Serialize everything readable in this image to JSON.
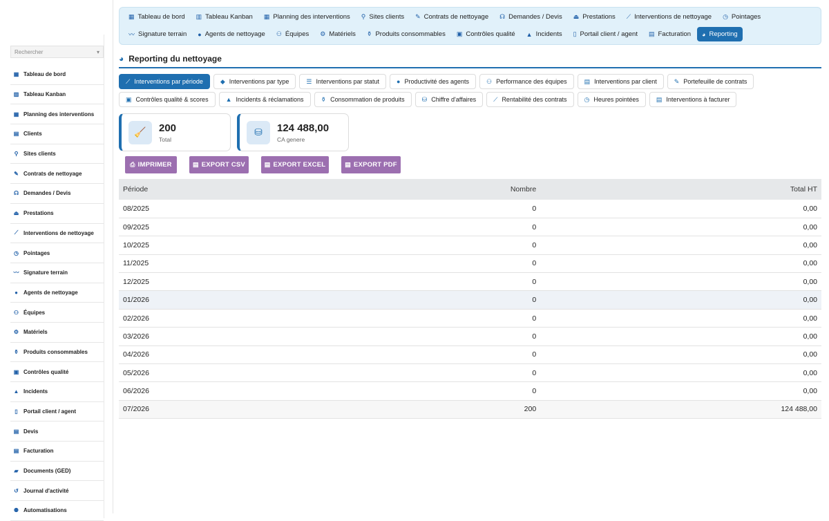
{
  "sidebar": {
    "search_placeholder": "Rechercher",
    "items": [
      {
        "label": "Tableau de bord",
        "icon": "dashboard-icon"
      },
      {
        "label": "Tableau Kanban",
        "icon": "kanban-icon"
      },
      {
        "label": "Planning des interventions",
        "icon": "calendar-icon"
      },
      {
        "label": "Clients",
        "icon": "building-icon"
      },
      {
        "label": "Sites clients",
        "icon": "map-pin-icon"
      },
      {
        "label": "Contrats de nettoyage",
        "icon": "contract-icon"
      },
      {
        "label": "Demandes / Devis",
        "icon": "headset-icon"
      },
      {
        "label": "Prestations",
        "icon": "service-icon"
      },
      {
        "label": "Interventions de nettoyage",
        "icon": "broom-icon"
      },
      {
        "label": "Pointages",
        "icon": "clock-icon"
      },
      {
        "label": "Signature terrain",
        "icon": "signature-icon"
      },
      {
        "label": "Agents de nettoyage",
        "icon": "user-icon"
      },
      {
        "label": "Équipes",
        "icon": "users-icon"
      },
      {
        "label": "Matériels",
        "icon": "cogs-icon"
      },
      {
        "label": "Produits consommables",
        "icon": "spray-icon"
      },
      {
        "label": "Contrôles qualité",
        "icon": "clipboard-check-icon"
      },
      {
        "label": "Incidents",
        "icon": "warning-icon"
      },
      {
        "label": "Portail client / agent",
        "icon": "mobile-icon"
      },
      {
        "label": "Devis",
        "icon": "file-icon"
      },
      {
        "label": "Facturation",
        "icon": "invoice-icon"
      },
      {
        "label": "Documents (GED)",
        "icon": "folder-icon"
      },
      {
        "label": "Journal d'activité",
        "icon": "history-icon"
      },
      {
        "label": "Automatisations",
        "icon": "robot-icon"
      }
    ]
  },
  "topnav": {
    "row1": [
      {
        "label": "Tableau de bord",
        "icon": "dashboard-icon"
      },
      {
        "label": "Tableau Kanban",
        "icon": "kanban-icon"
      },
      {
        "label": "Planning des interventions",
        "icon": "calendar-icon"
      },
      {
        "label": "Sites clients",
        "icon": "map-pin-icon"
      },
      {
        "label": "Contrats de nettoyage",
        "icon": "contract-icon"
      },
      {
        "label": "Demandes / Devis",
        "icon": "headset-icon"
      },
      {
        "label": "Prestations",
        "icon": "service-icon"
      },
      {
        "label": "Interventions de nettoyage",
        "icon": "broom-icon"
      },
      {
        "label": "Pointages",
        "icon": "clock-icon"
      }
    ],
    "row2": [
      {
        "label": "Signature terrain",
        "icon": "signature-icon"
      },
      {
        "label": "Agents de nettoyage",
        "icon": "user-icon"
      },
      {
        "label": "Équipes",
        "icon": "users-icon"
      },
      {
        "label": "Matériels",
        "icon": "cogs-icon"
      },
      {
        "label": "Produits consommables",
        "icon": "spray-icon"
      },
      {
        "label": "Contrôles qualité",
        "icon": "clipboard-check-icon"
      },
      {
        "label": "Incidents",
        "icon": "warning-icon"
      },
      {
        "label": "Portail client / agent",
        "icon": "mobile-icon"
      },
      {
        "label": "Facturation",
        "icon": "invoice-icon"
      },
      {
        "label": "Reporting",
        "icon": "pie-chart-icon",
        "active": true
      }
    ]
  },
  "page": {
    "title": "Reporting du nettoyage"
  },
  "tabs": {
    "row1": [
      {
        "label": "Interventions par période",
        "icon": "broom-icon",
        "active": true
      },
      {
        "label": "Interventions par type",
        "icon": "tag-icon"
      },
      {
        "label": "Interventions par statut",
        "icon": "list-icon"
      },
      {
        "label": "Productivité des agents",
        "icon": "user-icon"
      },
      {
        "label": "Performance des équipes",
        "icon": "users-icon"
      },
      {
        "label": "Interventions par client",
        "icon": "building-icon"
      },
      {
        "label": "Portefeuille de contrats",
        "icon": "contract-icon"
      }
    ],
    "row2": [
      {
        "label": "Contrôles qualité & scores",
        "icon": "clipboard-check-icon"
      },
      {
        "label": "Incidents & réclamations",
        "icon": "warning-icon"
      },
      {
        "label": "Consommation de produits",
        "icon": "spray-icon"
      },
      {
        "label": "Chiffre d'affaires",
        "icon": "coins-icon"
      },
      {
        "label": "Rentabilité des contrats",
        "icon": "line-chart-icon"
      },
      {
        "label": "Heures pointées",
        "icon": "clock-icon"
      },
      {
        "label": "Interventions à facturer",
        "icon": "invoice-icon"
      }
    ]
  },
  "kpis": [
    {
      "value": "200",
      "label": "Total",
      "icon": "broom-icon"
    },
    {
      "value": "124 488,00",
      "label": "CA genere",
      "icon": "coins-icon"
    }
  ],
  "actions": {
    "print": "IMPRIMER",
    "csv": "EXPORT CSV",
    "excel": "EXPORT EXCEL",
    "pdf": "EXPORT PDF"
  },
  "table": {
    "headers": [
      "Période",
      "Nombre",
      "Total HT"
    ],
    "rows": [
      [
        "08/2025",
        "0",
        "0,00"
      ],
      [
        "09/2025",
        "0",
        "0,00"
      ],
      [
        "10/2025",
        "0",
        "0,00"
      ],
      [
        "11/2025",
        "0",
        "0,00"
      ],
      [
        "12/2025",
        "0",
        "0,00"
      ],
      [
        "01/2026",
        "0",
        "0,00"
      ],
      [
        "02/2026",
        "0",
        "0,00"
      ],
      [
        "03/2026",
        "0",
        "0,00"
      ],
      [
        "04/2026",
        "0",
        "0,00"
      ],
      [
        "05/2026",
        "0",
        "0,00"
      ],
      [
        "06/2026",
        "0",
        "0,00"
      ],
      [
        "07/2026",
        "200",
        "124 488,00"
      ]
    ]
  },
  "colors": {
    "accent": "#1f6fb0",
    "button": "#9c6fb0",
    "nav_bg": "#e1f1fa"
  }
}
